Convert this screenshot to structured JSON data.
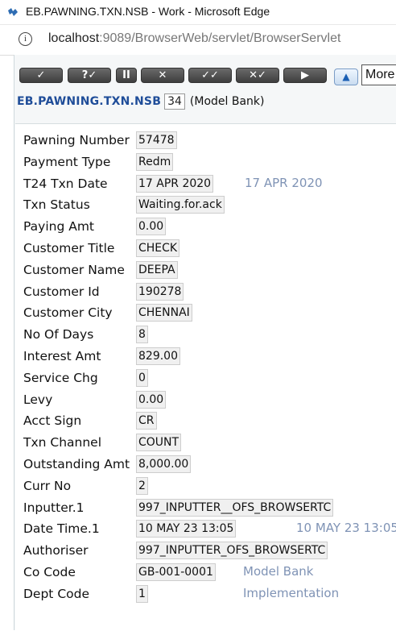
{
  "window": {
    "title": "EB.PAWNING.TXN.NSB - Work - Microsoft Edge"
  },
  "address_bar": {
    "host": "localhost",
    "rest": ":9089/BrowserWeb/servlet/BrowserServlet"
  },
  "toolbar": {
    "buttons": [
      "✓",
      "?✓",
      "II",
      "✕",
      "✓✓",
      "✕✓",
      "▶"
    ],
    "more": "More"
  },
  "header": {
    "application": "EB.PAWNING.TXN.NSB",
    "function": "34",
    "company": "(Model Bank)"
  },
  "fields": [
    {
      "label": "Pawning Number",
      "value": "57478"
    },
    {
      "label": "Payment Type",
      "value": "Redm"
    },
    {
      "label": "T24 Txn Date",
      "value": "17 APR 2020",
      "enrichment": "17 APR 2020"
    },
    {
      "label": "Txn Status",
      "value": "Waiting.for.ack"
    },
    {
      "label": "Paying Amt",
      "value": "0.00"
    },
    {
      "label": "Customer Title",
      "value": "CHECK"
    },
    {
      "label": "Customer Name",
      "value": "DEEPA"
    },
    {
      "label": "Customer Id",
      "value": "190278"
    },
    {
      "label": "Customer City",
      "value": "CHENNAI"
    },
    {
      "label": "No Of Days",
      "value": "8"
    },
    {
      "label": "Interest Amt",
      "value": "829.00"
    },
    {
      "label": "Service Chg",
      "value": "0"
    },
    {
      "label": "Levy",
      "value": "0.00"
    },
    {
      "label": "Acct Sign",
      "value": "CR"
    },
    {
      "label": "Txn Channel",
      "value": "COUNT"
    },
    {
      "label": "Outstanding Amt",
      "value": "8,000.00"
    },
    {
      "label": "Curr No",
      "value": "2"
    },
    {
      "label": "Inputter.1",
      "value": "997_INPUTTER__OFS_BROWSERTC"
    },
    {
      "label": "Date Time.1",
      "value": "10 MAY 23 13:05",
      "enrichment": "10 MAY 23 13:05"
    },
    {
      "label": "Authoriser",
      "value": "997_INPUTTER_OFS_BROWSERTC"
    },
    {
      "label": "Co Code",
      "value": "GB-001-0001",
      "enrichment": "Model Bank"
    },
    {
      "label": "Dept Code",
      "value": "1",
      "enrichment": "Implementation"
    }
  ]
}
